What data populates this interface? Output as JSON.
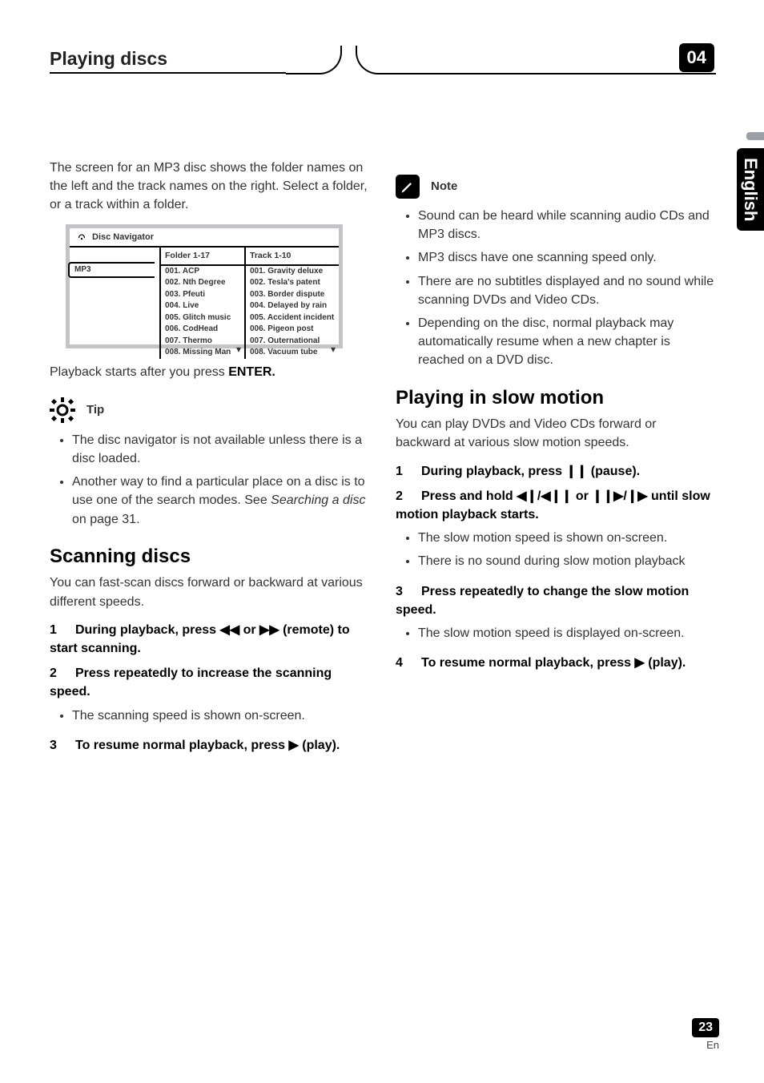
{
  "header": {
    "title": "Playing discs",
    "chapter": "04"
  },
  "side_tab": "English",
  "left": {
    "intro": "The screen for an MP3 disc shows the folder names on the left and the track names on the right. Select a folder, or a track within a folder.",
    "nav": {
      "title": "Disc Navigator",
      "folder_header": "Folder 1-17",
      "track_header": "Track 1-10",
      "mp3_label": "MP3",
      "folders": [
        "001. ACP",
        "002. Nth Degree",
        "003. Pfeuti",
        "004. Live",
        "005. Glitch music",
        "006. CodHead",
        "007. Thermo",
        "008. Missing Man"
      ],
      "tracks": [
        "001. Gravity deluxe",
        "002. Tesla's patent",
        "003. Border dispute",
        "004. Delayed by rain",
        "005. Accident incident",
        "006. Pigeon post",
        "007. Outernational",
        "008. Vacuum tube"
      ]
    },
    "after_nav_a": "Playback starts after you press ",
    "after_nav_b": "ENTER.",
    "tip_label": "Tip",
    "tips": [
      "The disc navigator is not available unless there is a disc loaded.",
      "Another way to find a particular place on a disc is to use one of the search modes. See Searching a disc on page 31."
    ],
    "tip2_prefix": "Another way to find a particular place on a disc is to use one of the search modes. See ",
    "tip2_em": "Searching a disc",
    "tip2_suffix": " on page 31.",
    "scan_heading": "Scanning discs",
    "scan_intro": "You can fast-scan discs forward or backward at various different speeds.",
    "scan_step1_num": "1",
    "scan_step1_a": "During playback, press ",
    "scan_step1_glyph": "◀◀ or ▶▶",
    "scan_step1_b": " (remote) to start scanning.",
    "scan_step2_num": "2",
    "scan_step2": "Press repeatedly to increase the scanning speed.",
    "scan_step2_bullet": "The scanning speed is shown on-screen.",
    "scan_step3_num": "3",
    "scan_step3_a": "To resume normal playback, press ",
    "scan_step3_glyph": "▶",
    "scan_step3_b": " (play)."
  },
  "right": {
    "note_label": "Note",
    "notes": [
      "Sound can be heard while scanning audio CDs and MP3 discs.",
      "MP3 discs have one scanning speed only.",
      "There are no subtitles displayed and no sound while scanning DVDs and Video CDs.",
      "Depending on the disc, normal playback may automatically resume when a new chapter is reached on a DVD disc."
    ],
    "slow_heading": "Playing in slow motion",
    "slow_intro": "You can play DVDs and Video CDs forward or backward at various slow motion speeds.",
    "slow1_num": "1",
    "slow1_a": "During playback, press ",
    "slow1_glyph": "❙❙",
    "slow1_b": " (pause).",
    "slow2_num": "2",
    "slow2_a": "Press and hold ",
    "slow2_glyph": "◀❙/◀❙❙ or ❙❙▶/❙▶",
    "slow2_b": " until slow motion playback starts.",
    "slow2_bullets": [
      "The slow motion speed is shown on-screen.",
      "There is no sound during slow motion playback"
    ],
    "slow3_num": "3",
    "slow3": "Press repeatedly to change the slow motion speed.",
    "slow3_bullet": "The slow motion speed is displayed on-screen.",
    "slow4_num": "4",
    "slow4_a": "To resume normal playback, press ",
    "slow4_glyph": "▶",
    "slow4_b": " (play)."
  },
  "footer": {
    "pagenum": "23",
    "lang": "En"
  }
}
